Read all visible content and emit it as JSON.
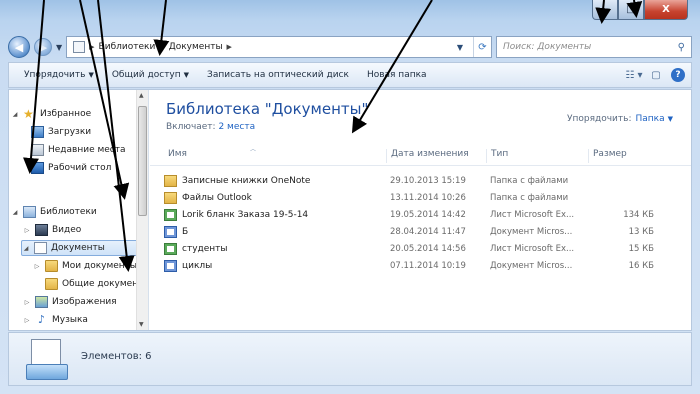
{
  "window": {
    "buttons": {
      "minimize": "–",
      "maximize": "□",
      "close": "X"
    }
  },
  "address": {
    "crumbs": [
      "Библиотеки",
      "Документы"
    ],
    "search_placeholder": "Поиск: Документы"
  },
  "toolbar": {
    "items": [
      "Упорядочить",
      "Общий доступ",
      "Записать на оптический диск",
      "Новая папка"
    ]
  },
  "nav": {
    "favorites_label": "Избранное",
    "favorites": [
      "Загрузки",
      "Недавние места",
      "Рабочий стол"
    ],
    "libraries_label": "Библиотеки",
    "libraries": [
      "Видео",
      "Документы",
      "Мои документы",
      "Общие документы",
      "Изображения",
      "Музыка"
    ]
  },
  "library": {
    "title": "Библиотека \"Документы\"",
    "includes_label": "Включает:",
    "includes_link": "2 места",
    "arrange_label": "Упорядочить:",
    "arrange_value": "Папка"
  },
  "columns": {
    "name": "Имя",
    "date": "Дата изменения",
    "type": "Тип",
    "size": "Размер"
  },
  "files": [
    {
      "icon": "folder-icon",
      "name": "Записные книжки OneNote",
      "date": "29.10.2013 15:19",
      "type": "Папка с файлами",
      "size": ""
    },
    {
      "icon": "folder-icon",
      "name": "Файлы Outlook",
      "date": "13.11.2014 10:26",
      "type": "Папка с файлами",
      "size": ""
    },
    {
      "icon": "excel-file-icon",
      "name": "Lorik бланк Заказа 19-5-14",
      "date": "19.05.2014 14:42",
      "type": "Лист Microsoft Ex...",
      "size": "134 КБ"
    },
    {
      "icon": "word-file-icon",
      "name": "Б",
      "date": "28.04.2014 11:47",
      "type": "Документ Micros...",
      "size": "13 КБ"
    },
    {
      "icon": "excel-file-icon",
      "name": "студенты",
      "date": "20.05.2014 14:56",
      "type": "Лист Microsoft Ex...",
      "size": "15 КБ"
    },
    {
      "icon": "word-file-icon",
      "name": "циклы",
      "date": "07.11.2014 10:19",
      "type": "Документ Micros...",
      "size": "16 КБ"
    }
  ],
  "details": {
    "count": "Элементов: 6"
  },
  "colors": {
    "title_blue": "#1f4fa0",
    "link_blue": "#1f63c3",
    "close_red": "#c7432f"
  }
}
